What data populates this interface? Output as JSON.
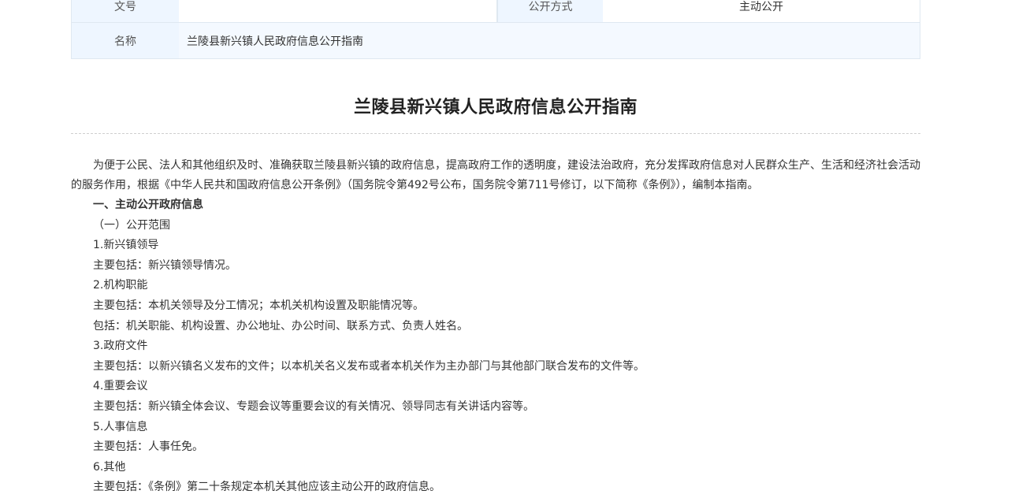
{
  "meta": {
    "doc_no_label": "文号",
    "doc_no_value": "",
    "publish_mode_label": "公开方式",
    "publish_mode_value": "主动公开",
    "name_label": "名称",
    "name_value": "兰陵县新兴镇人民政府信息公开指南"
  },
  "article": {
    "title": "兰陵县新兴镇人民政府信息公开指南",
    "paragraphs": [
      "为便于公民、法人和其他组织及时、准确获取兰陵县新兴镇的政府信息，提高政府工作的透明度，建设法治政府，充分发挥政府信息对人民群众生产、生活和经济社会活动的服务作用，根据《中华人民共和国政府信息公开条例》（国务院令第492号公布，国务院令第711号修订，以下简称《条例》），编制本指南。",
      "一、主动公开政府信息",
      "（一）公开范围",
      "1.新兴镇领导",
      "主要包括：新兴镇领导情况。",
      "2.机构职能",
      "主要包括：本机关领导及分工情况；本机关机构设置及职能情况等。",
      "包括：机关职能、机构设置、办公地址、办公时间、联系方式、负责人姓名。",
      "3.政府文件",
      "主要包括：以新兴镇名义发布的文件；以本机关名义发布或者本机关作为主办部门与其他部门联合发布的文件等。",
      "4.重要会议",
      "主要包括：新兴镇全体会议、专题会议等重要会议的有关情况、领导同志有关讲话内容等。",
      "5.人事信息",
      "主要包括：人事任免。",
      "6.其他",
      "主要包括：《条例》第二十条规定本机关其他应该主动公开的政府信息。"
    ]
  }
}
